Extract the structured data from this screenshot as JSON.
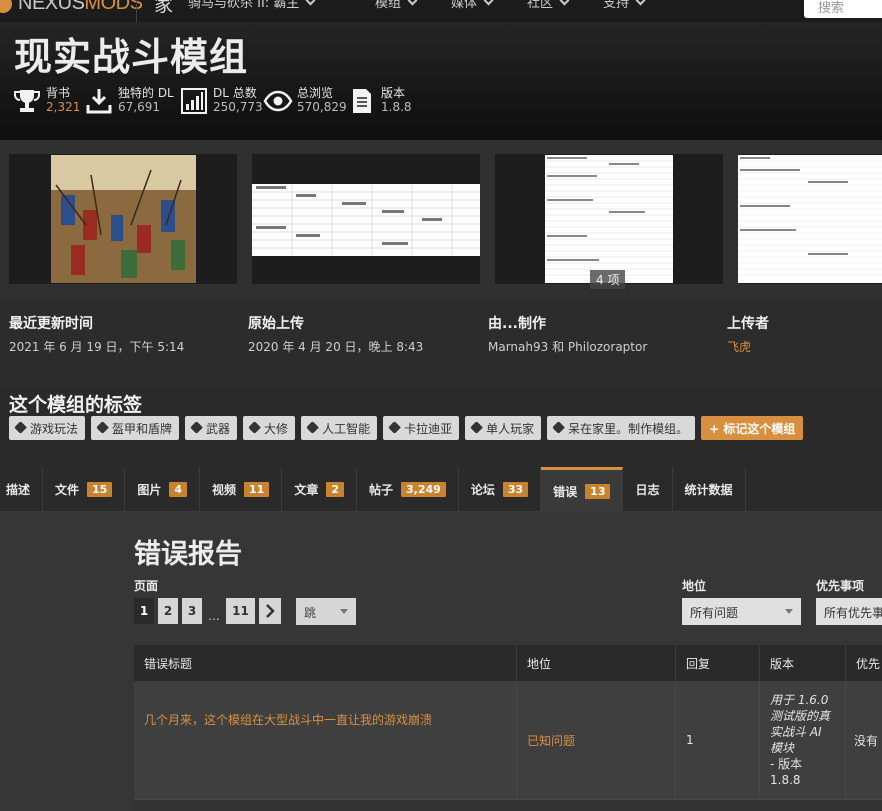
{
  "nav": {
    "logo_prefix": "NEXUS",
    "logo_suffix": "MODS",
    "home_label": "家",
    "game_name": "骑马与砍杀 II: 霸主",
    "menus": [
      "模组",
      "媒体",
      "社区",
      "支持"
    ],
    "search_placeholder": "搜索"
  },
  "hero": {
    "title": "现实战斗模组",
    "stats": [
      {
        "icon": "trophy-icon",
        "label": "背书",
        "value": "2,321"
      },
      {
        "icon": "download-icon",
        "label": "独特的 DL",
        "value": "67,691"
      },
      {
        "icon": "bar-chart-icon",
        "label": "DL 总数",
        "value": "250,773"
      },
      {
        "icon": "eye-icon",
        "label": "总浏览",
        "value": "570,829"
      },
      {
        "icon": "document-icon",
        "label": "版本",
        "value": "1.8.8"
      }
    ]
  },
  "gallery": {
    "count_label": "4 项"
  },
  "meta": {
    "last_updated_label": "最近更新时间",
    "last_updated_value": "2021 年 6 月 19 日，下午 5:14",
    "original_upload_label": "原始上传",
    "original_upload_value": "2020 年 4 月 20 日，晚上 8:43",
    "created_by_label": "由...制作",
    "created_by_value": "Marnah93 和 Philozoraptor",
    "uploader_label": "上传者",
    "uploader_value": "飞虎"
  },
  "tags": {
    "heading": "这个模组的标签",
    "items": [
      "游戏玩法",
      "盔甲和盾牌",
      "武器",
      "大修",
      "人工智能",
      "卡拉迪亚",
      "单人玩家",
      "呆在家里。制作模组。"
    ],
    "add_label": "+ 标记这个模组"
  },
  "tabs": [
    {
      "label": "描述",
      "count": ""
    },
    {
      "label": "文件",
      "count": "15"
    },
    {
      "label": "图片",
      "count": "4"
    },
    {
      "label": "视频",
      "count": "11"
    },
    {
      "label": "文章",
      "count": "2"
    },
    {
      "label": "帖子",
      "count": "3,249"
    },
    {
      "label": "论坛",
      "count": "33"
    },
    {
      "label": "错误",
      "count": "13"
    },
    {
      "label": "日志",
      "count": ""
    },
    {
      "label": "统计数据",
      "count": ""
    }
  ],
  "bugs": {
    "heading": "错误报告",
    "page_label": "页面",
    "pages": [
      "1",
      "2",
      "3",
      "11"
    ],
    "ellipsis": "...",
    "jump_label": "跳",
    "status_label": "地位",
    "status_value": "所有问题",
    "priority_label": "优先事项",
    "priority_value": "所有优先事项",
    "columns": [
      "错误标题",
      "地位",
      "回复",
      "版本",
      "优先"
    ],
    "rows": [
      {
        "title": "几个月来，这个模组在大型战斗中一直让我的游戏崩溃",
        "status": "已知问题",
        "replies": "1",
        "version_italic": "用于 1.6.0 测试版的真实战斗 AI 模块",
        "version_plain": "- 版本 1.8.8",
        "priority": "没有"
      }
    ]
  }
}
